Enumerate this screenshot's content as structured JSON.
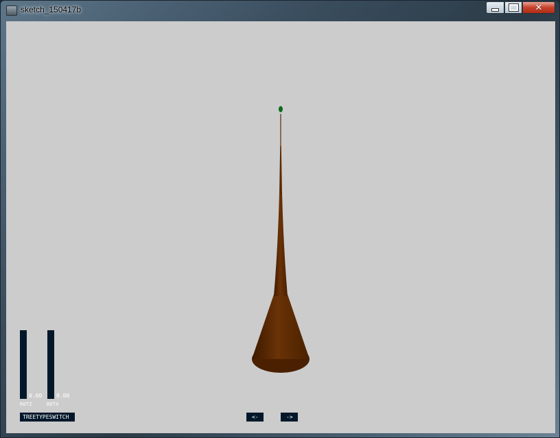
{
  "window": {
    "title": "sketch_150417b",
    "controls": {
      "minimize_icon": "minimize-icon",
      "maximize_icon": "maximize-icon",
      "close_label": "✕"
    }
  },
  "canvas": {
    "background": "#cccccc",
    "tree": {
      "trunk_color": "#5a2a00",
      "leaf_color": "#0b6a1e"
    }
  },
  "controls": {
    "sliders": [
      {
        "label": "ROTZ",
        "value": "0.00"
      },
      {
        "label": "ROTX",
        "value": "0.00"
      }
    ],
    "buttons": {
      "tree_type_switch": "TREETYPESWITCH",
      "prev": "<-",
      "next": "->"
    },
    "panel_color": "#02182a"
  }
}
